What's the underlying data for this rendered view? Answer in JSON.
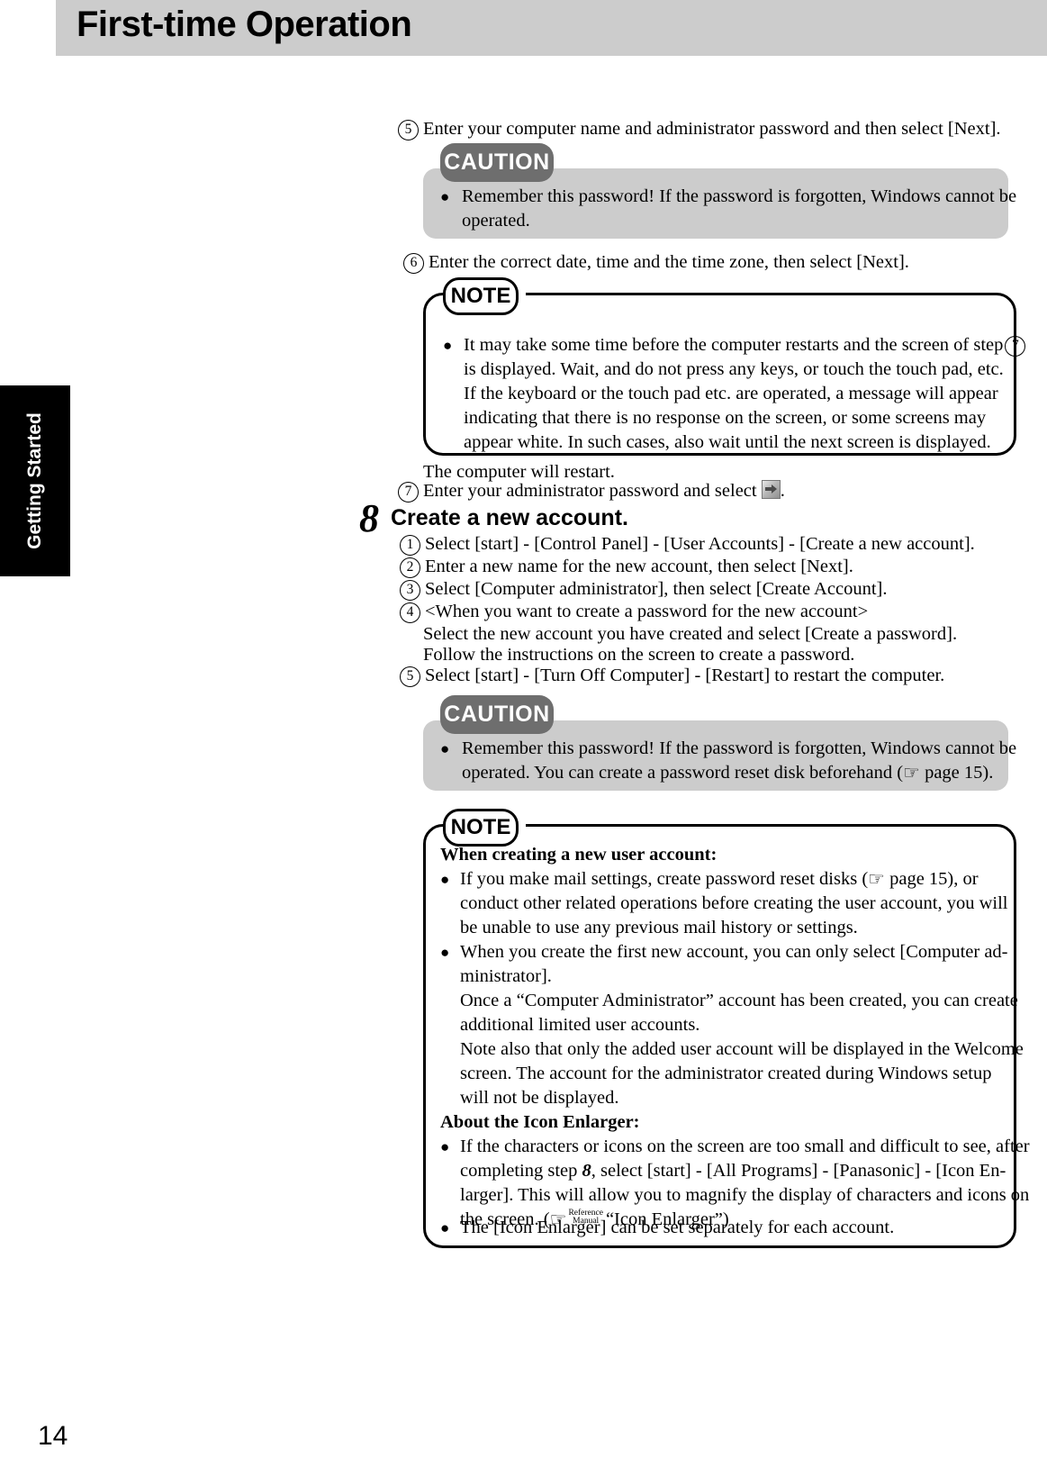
{
  "header": {
    "title": "First-time Operation",
    "band_color": "#cccccc"
  },
  "side_tab": {
    "label": "Getting Started",
    "background": "#000000",
    "text_color": "#ffffff"
  },
  "footer": {
    "page_number": "14"
  },
  "icons": {
    "arrow_button": "arrow-right-button-icon",
    "page_ref_hand": "☞",
    "reference_manual_line1": "Reference",
    "reference_manual_line2": "Manual"
  },
  "steps": {
    "step5": {
      "number": "5",
      "text": "Enter your computer name and administrator password and then select [Next]."
    },
    "step6": {
      "number": "6",
      "text": "Enter the correct date, time and the time zone, then select [Next]."
    },
    "restart_note": "The computer will restart.",
    "step7": {
      "number": "7",
      "text_before": "Enter your administrator password and select",
      "text_after": "."
    }
  },
  "caution1": {
    "label": "CAUTION",
    "lines": [
      "Remember this password!  If the password is forgotten, Windows cannot be",
      "operated."
    ]
  },
  "note1": {
    "label": "NOTE",
    "lines": [
      "It may take some time before the computer restarts and the screen of step",
      "is displayed. Wait, and do not press any keys, or touch the touch pad, etc.",
      "If the keyboard or the touch pad etc. are operated, a message will appear",
      "indicating that there is no response on the screen, or some screens may",
      "appear white. In such cases, also wait until the next screen is displayed."
    ],
    "inline_step_ref": "7"
  },
  "section8": {
    "number": "8",
    "title": "Create a new account.",
    "items": [
      {
        "number": "1",
        "lines": [
          "Select [start] - [Control Panel] - [User Accounts] - [Create a new account]."
        ]
      },
      {
        "number": "2",
        "lines": [
          "Enter a new name for the new account, then select [Next]."
        ]
      },
      {
        "number": "3",
        "lines": [
          "Select [Computer administrator], then select [Create Account]."
        ]
      },
      {
        "number": "4",
        "lines": [
          "<When you want to create a password for the new account>",
          "Select the new account you have created and select [Create a password].",
          "Follow the instructions on the screen to create a password."
        ]
      },
      {
        "number": "5",
        "lines": [
          "Select [start] - [Turn Off Computer] - [Restart] to restart the computer."
        ]
      }
    ]
  },
  "caution2": {
    "label": "CAUTION",
    "line1": "Remember this password!  If the password is forgotten, Windows cannot be",
    "line2_a": "operated. You can create a password reset disk beforehand (",
    "line2_b": "page 15)."
  },
  "note2": {
    "label": "NOTE",
    "heading1": "When creating a new user account:",
    "b1_l1_a": "If you make mail settings, create password reset disks (",
    "b1_l1_b": "page 15), or",
    "b1_l2": "conduct other related operations before creating the user account, you will",
    "b1_l3": "be unable to use any previous mail history or settings.",
    "b2_l1": "When you create the first new account, you can only select [Computer ad-",
    "b2_l2": "ministrator].",
    "b2_l3": "Once a “Computer Administrator” account has been created, you can create",
    "b2_l4": "additional limited user accounts.",
    "b2_l5": "Note also that only the added user account will be displayed in the Welcome",
    "b2_l6": "screen. The account for the administrator created during Windows setup",
    "b2_l7": "will not be displayed.",
    "heading2": "About the Icon Enlarger:",
    "b3_l1": "If the characters or icons on the screen are too small and difficult to see, after",
    "b3_l2_a": "completing step",
    "b3_l2_num": "8",
    "b3_l2_b": ", select [start] - [All Programs] - [Panasonic] - [Icon En-",
    "b3_l3": "larger]. This will allow you to magnify the display of characters and icons on",
    "b3_l4_a": "the screen. (",
    "b3_l4_b": "“Icon Enlarger”)",
    "b4_l1": "The [Icon Enlarger] can be set separately for each account."
  }
}
